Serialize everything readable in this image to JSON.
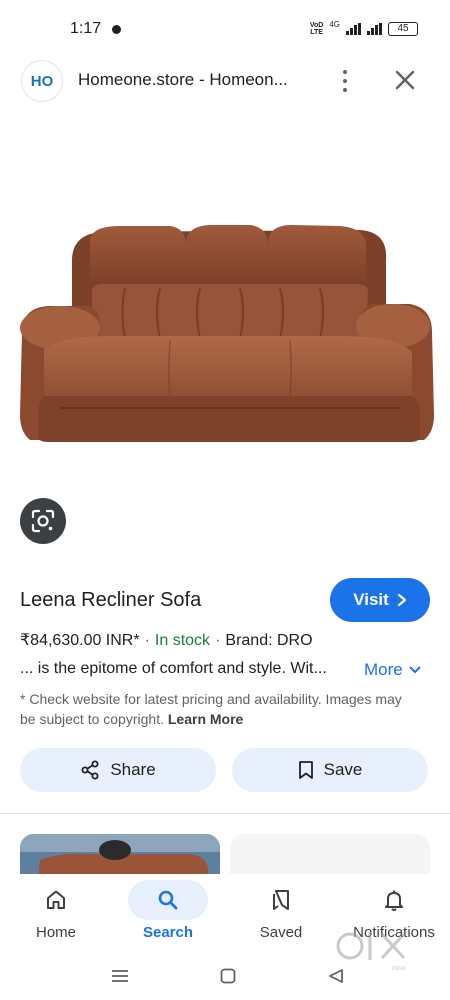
{
  "status_bar": {
    "time": "1:17",
    "volte_top": "VoD",
    "volte_bottom": "LTE",
    "network": "4G",
    "battery": "45"
  },
  "header": {
    "logo_text": "HO",
    "site_title": "Homeone.store - Homeon..."
  },
  "product": {
    "title": "Leena Recliner Sofa",
    "visit_label": "Visit",
    "price": "₹84,630.00 INR*",
    "separator": "·",
    "stock": "In stock",
    "brand": "Brand: DRO",
    "description": "... is the epitome of comfort and style. Wit...",
    "more_label": "More",
    "disclaimer": "* Check website for latest pricing and availability. Images may be subject to copyright.",
    "learn_more": "Learn More"
  },
  "actions": {
    "share_label": "Share",
    "save_label": "Save"
  },
  "bottom_nav": {
    "items": [
      {
        "label": "Home",
        "icon": "home-icon"
      },
      {
        "label": "Search",
        "icon": "search-icon",
        "active": true
      },
      {
        "label": "Saved",
        "icon": "saved-icon"
      },
      {
        "label": "Notifications",
        "icon": "bell-icon"
      }
    ]
  },
  "watermark": {
    "logo_text": "OLX",
    "sub_text": "INDIA"
  },
  "colors": {
    "accent": "#1a73e8",
    "in_stock": "#188038",
    "chip_bg": "#e8f0fe",
    "sofa": "#8a4b33"
  }
}
